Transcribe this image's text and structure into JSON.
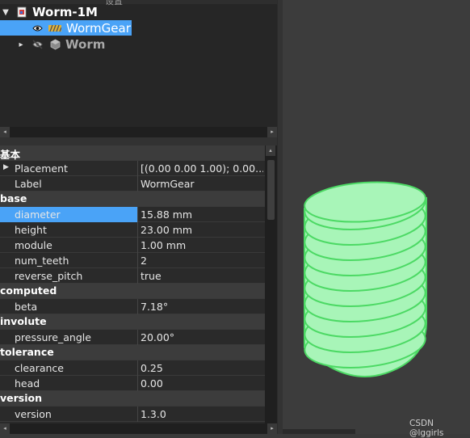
{
  "tree": {
    "top_text": "设置",
    "document": {
      "title": "Worm-1M",
      "expand_icon": "triangle-down"
    },
    "items": [
      {
        "label": "WormGear",
        "selected": true,
        "visibility_icon": "eye-icon",
        "type_icon": "gear-icon"
      },
      {
        "label": "Worm",
        "selected": false,
        "visibility_icon": "eye-hidden-icon",
        "type_icon": "cube-icon"
      }
    ]
  },
  "properties": {
    "groups": [
      {
        "name": "基本",
        "rows": [
          {
            "name": "Placement",
            "value": "[(0.00 0.00 1.00); 0.00...",
            "expandable": true
          },
          {
            "name": "Label",
            "value": "WormGear"
          }
        ]
      },
      {
        "name": "base",
        "rows": [
          {
            "name": "diameter",
            "value": "15.88 mm",
            "selected": true
          },
          {
            "name": "height",
            "value": "23.00 mm"
          },
          {
            "name": "module",
            "value": "1.00 mm"
          },
          {
            "name": "num_teeth",
            "value": "2"
          },
          {
            "name": "reverse_pitch",
            "value": "true"
          }
        ]
      },
      {
        "name": "computed",
        "rows": [
          {
            "name": "beta",
            "value": "7.18°"
          }
        ]
      },
      {
        "name": "involute",
        "rows": [
          {
            "name": "pressure_angle",
            "value": "20.00°"
          }
        ]
      },
      {
        "name": "tolerance",
        "rows": [
          {
            "name": "clearance",
            "value": "0.25"
          },
          {
            "name": "head",
            "value": "0.00"
          }
        ]
      },
      {
        "name": "version",
        "rows": [
          {
            "name": "version",
            "value": "1.3.0"
          }
        ]
      }
    ]
  },
  "watermark": "CSDN @lggirls",
  "colors": {
    "selection": "#4aa3f7",
    "gear_fill": "#a8f5b8",
    "gear_stroke": "#4cd964"
  }
}
